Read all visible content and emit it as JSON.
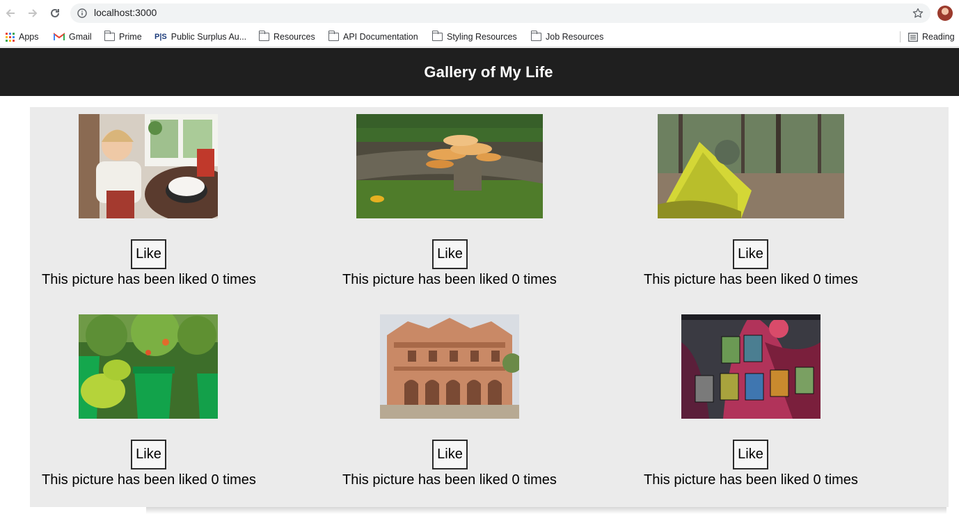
{
  "browser": {
    "url": "localhost:3000",
    "bookmarks": [
      {
        "label": "Apps",
        "icon": "apps-grid-icon"
      },
      {
        "label": "Gmail",
        "icon": "gmail-icon"
      },
      {
        "label": "Prime",
        "icon": "folder-icon"
      },
      {
        "label": "Public Surplus Au...",
        "icon": "public-surplus-icon"
      },
      {
        "label": "Resources",
        "icon": "folder-icon"
      },
      {
        "label": "API Documentation",
        "icon": "folder-icon"
      },
      {
        "label": "Styling Resources",
        "icon": "folder-icon"
      },
      {
        "label": "Job Resources",
        "icon": "folder-icon"
      }
    ],
    "reading_list": "Reading"
  },
  "header": {
    "title": "Gallery of My Life"
  },
  "gallery": {
    "items": [
      {
        "alt": "birthday photo",
        "like_label": "Like",
        "caption": "This picture has been liked 0 times"
      },
      {
        "alt": "mushrooms on log",
        "like_label": "Like",
        "caption": "This picture has been liked 0 times"
      },
      {
        "alt": "tent in forest",
        "like_label": "Like",
        "caption": "This picture has been liked 0 times"
      },
      {
        "alt": "pepper plants in buckets",
        "like_label": "Like",
        "caption": "This picture has been liked 0 times"
      },
      {
        "alt": "ornate palace",
        "like_label": "Like",
        "caption": "This picture has been liked 0 times"
      },
      {
        "alt": "magic cards on playmat",
        "like_label": "Like",
        "caption": "This picture has been liked 0 times"
      }
    ]
  }
}
